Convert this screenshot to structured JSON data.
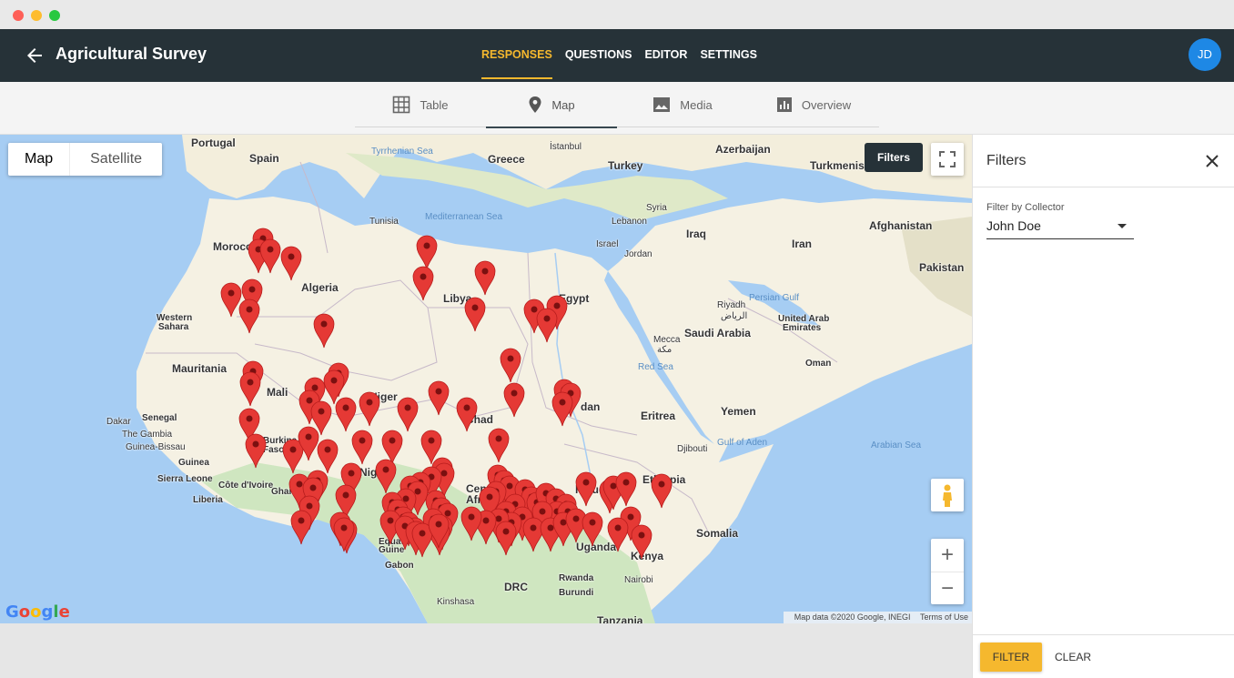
{
  "window": {
    "controls": [
      "close",
      "minimize",
      "maximize"
    ]
  },
  "appbar": {
    "back_icon": "arrow-back-icon",
    "title": "Agricultural Survey",
    "tabs": [
      {
        "label": "RESPONSES",
        "active": true
      },
      {
        "label": "QUESTIONS",
        "active": false
      },
      {
        "label": "EDITOR",
        "active": false
      },
      {
        "label": "SETTINGS",
        "active": false
      }
    ],
    "avatar_initials": "JD",
    "accent_color": "#f5b82e",
    "bar_color": "#263238"
  },
  "view_tabs": [
    {
      "label": "Table",
      "icon": "table-icon",
      "active": false
    },
    {
      "label": "Map",
      "icon": "map-pin-icon",
      "active": true
    },
    {
      "label": "Media",
      "icon": "image-icon",
      "active": false
    },
    {
      "label": "Overview",
      "icon": "bar-chart-icon",
      "active": false
    }
  ],
  "map": {
    "type_buttons": [
      "Map",
      "Satellite"
    ],
    "selected_type": "Map",
    "filters_chip": "Filters",
    "labels": {
      "portugal": "Portugal",
      "spain": "Spain",
      "tyrrhenian": "Tyrrhenian Sea",
      "istanbul": "İstanbul",
      "greece": "Greece",
      "turkey": "Turkey",
      "azerbaijan": "Azerbaijan",
      "turkmenistan": "Turkmenis",
      "tunisia": "Tunisia",
      "medsea": "Mediterranean Sea",
      "syria": "Syria",
      "lebanon": "Lebanon",
      "iraq": "Iraq",
      "afghanistan": "Afghanistan",
      "morocco": "Morocco",
      "israel": "Israel",
      "jordan": "Jordan",
      "iran": "Iran",
      "pakistan": "Pakistan",
      "algeria": "Algeria",
      "libya": "Libya",
      "egypt": "Egypt",
      "persiangulf": "Persian Gulf",
      "riyadh": "Riyadh",
      "riyadh_ar": "الرياض",
      "western": "Western",
      "sahara": "Sahara",
      "uae1": "United Arab",
      "uae2": "Emirates",
      "mecca": "Mecca",
      "mecca_ar": "مكة",
      "saudi": "Saudi Arabia",
      "mauritania": "Mauritania",
      "redsea": "Red Sea",
      "oman": "Oman",
      "mali": "Mali",
      "niger": "Niger",
      "sudan": "dan",
      "chad": "Chad",
      "eritrea": "Eritrea",
      "yemen": "Yemen",
      "dakar": "Dakar",
      "senegal": "Senegal",
      "burkina": "Burkina",
      "faso": "Faso",
      "gambia": "The Gambia",
      "guineabissau": "Guinea-Bissau",
      "gulfaden": "Gulf of Aden",
      "djibouti": "Djibouti",
      "arabiansea": "Arabian Sea",
      "guinea": "Guinea",
      "nigeria": "Niger",
      "sierraleone": "Sierra Leone",
      "ivory": "Côte d'Ivoire",
      "ghana": "Ghan",
      "car": "Cen",
      "car2": "Afr",
      "ssudan": "h Sudan",
      "ethiopia": "Ethiopia",
      "liberia": "Liberia",
      "somalia": "Somalia",
      "equatorial": "Equato",
      "guinea2": "Guine",
      "uganda": "Uganda",
      "kenya": "Kenya",
      "gabon": "Gabon",
      "drc": "DRC",
      "rwanda": "Rwanda",
      "nairobi": "Nairobi",
      "burundi": "Burundi",
      "kinshasa": "Kinshasa",
      "tanzania": "Tanzania"
    },
    "attribution": "Map data ©2020 Google, INEGI",
    "terms": "Terms of Use",
    "google_logo": "Google",
    "marker_color": "#e53935",
    "land_color": "#f5f1e3",
    "water_color": "#a6cdf3"
  },
  "filters_panel": {
    "title": "Filters",
    "close_icon": "close-icon",
    "collector_label": "Filter by Collector",
    "collector_value": "John Doe",
    "filter_button": "FILTER",
    "clear_button": "CLEAR"
  }
}
